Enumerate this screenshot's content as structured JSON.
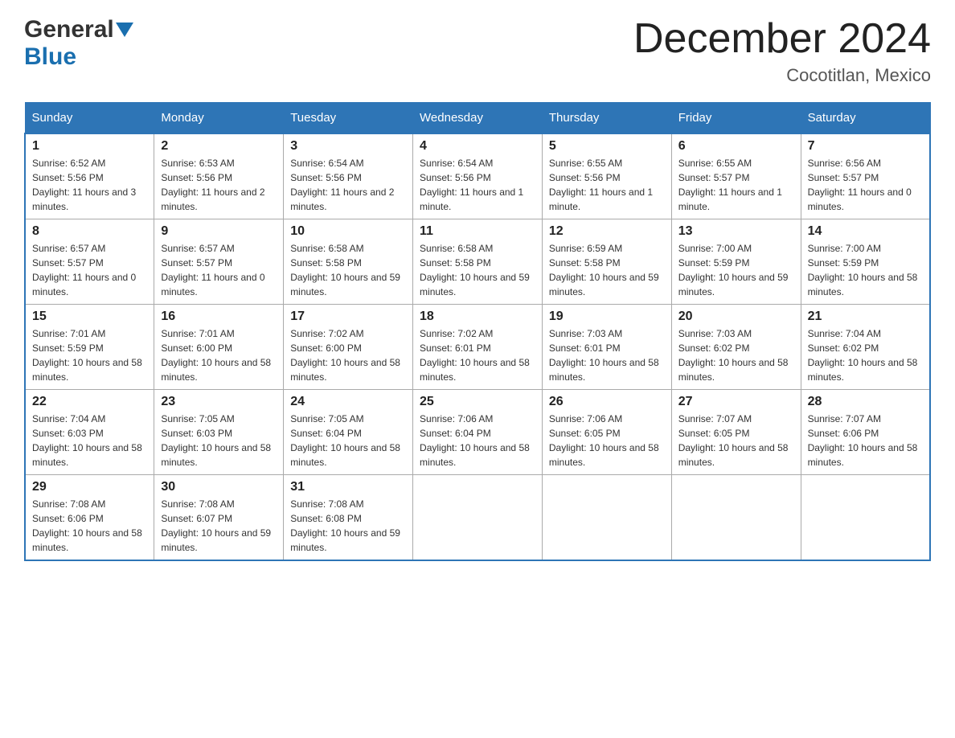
{
  "header": {
    "title": "December 2024",
    "location": "Cocotitlan, Mexico",
    "logo_general": "General",
    "logo_blue": "Blue"
  },
  "days_of_week": [
    "Sunday",
    "Monday",
    "Tuesday",
    "Wednesday",
    "Thursday",
    "Friday",
    "Saturday"
  ],
  "weeks": [
    [
      {
        "day": "1",
        "sunrise": "6:52 AM",
        "sunset": "5:56 PM",
        "daylight": "11 hours and 3 minutes."
      },
      {
        "day": "2",
        "sunrise": "6:53 AM",
        "sunset": "5:56 PM",
        "daylight": "11 hours and 2 minutes."
      },
      {
        "day": "3",
        "sunrise": "6:54 AM",
        "sunset": "5:56 PM",
        "daylight": "11 hours and 2 minutes."
      },
      {
        "day": "4",
        "sunrise": "6:54 AM",
        "sunset": "5:56 PM",
        "daylight": "11 hours and 1 minute."
      },
      {
        "day": "5",
        "sunrise": "6:55 AM",
        "sunset": "5:56 PM",
        "daylight": "11 hours and 1 minute."
      },
      {
        "day": "6",
        "sunrise": "6:55 AM",
        "sunset": "5:57 PM",
        "daylight": "11 hours and 1 minute."
      },
      {
        "day": "7",
        "sunrise": "6:56 AM",
        "sunset": "5:57 PM",
        "daylight": "11 hours and 0 minutes."
      }
    ],
    [
      {
        "day": "8",
        "sunrise": "6:57 AM",
        "sunset": "5:57 PM",
        "daylight": "11 hours and 0 minutes."
      },
      {
        "day": "9",
        "sunrise": "6:57 AM",
        "sunset": "5:57 PM",
        "daylight": "11 hours and 0 minutes."
      },
      {
        "day": "10",
        "sunrise": "6:58 AM",
        "sunset": "5:58 PM",
        "daylight": "10 hours and 59 minutes."
      },
      {
        "day": "11",
        "sunrise": "6:58 AM",
        "sunset": "5:58 PM",
        "daylight": "10 hours and 59 minutes."
      },
      {
        "day": "12",
        "sunrise": "6:59 AM",
        "sunset": "5:58 PM",
        "daylight": "10 hours and 59 minutes."
      },
      {
        "day": "13",
        "sunrise": "7:00 AM",
        "sunset": "5:59 PM",
        "daylight": "10 hours and 59 minutes."
      },
      {
        "day": "14",
        "sunrise": "7:00 AM",
        "sunset": "5:59 PM",
        "daylight": "10 hours and 58 minutes."
      }
    ],
    [
      {
        "day": "15",
        "sunrise": "7:01 AM",
        "sunset": "5:59 PM",
        "daylight": "10 hours and 58 minutes."
      },
      {
        "day": "16",
        "sunrise": "7:01 AM",
        "sunset": "6:00 PM",
        "daylight": "10 hours and 58 minutes."
      },
      {
        "day": "17",
        "sunrise": "7:02 AM",
        "sunset": "6:00 PM",
        "daylight": "10 hours and 58 minutes."
      },
      {
        "day": "18",
        "sunrise": "7:02 AM",
        "sunset": "6:01 PM",
        "daylight": "10 hours and 58 minutes."
      },
      {
        "day": "19",
        "sunrise": "7:03 AM",
        "sunset": "6:01 PM",
        "daylight": "10 hours and 58 minutes."
      },
      {
        "day": "20",
        "sunrise": "7:03 AM",
        "sunset": "6:02 PM",
        "daylight": "10 hours and 58 minutes."
      },
      {
        "day": "21",
        "sunrise": "7:04 AM",
        "sunset": "6:02 PM",
        "daylight": "10 hours and 58 minutes."
      }
    ],
    [
      {
        "day": "22",
        "sunrise": "7:04 AM",
        "sunset": "6:03 PM",
        "daylight": "10 hours and 58 minutes."
      },
      {
        "day": "23",
        "sunrise": "7:05 AM",
        "sunset": "6:03 PM",
        "daylight": "10 hours and 58 minutes."
      },
      {
        "day": "24",
        "sunrise": "7:05 AM",
        "sunset": "6:04 PM",
        "daylight": "10 hours and 58 minutes."
      },
      {
        "day": "25",
        "sunrise": "7:06 AM",
        "sunset": "6:04 PM",
        "daylight": "10 hours and 58 minutes."
      },
      {
        "day": "26",
        "sunrise": "7:06 AM",
        "sunset": "6:05 PM",
        "daylight": "10 hours and 58 minutes."
      },
      {
        "day": "27",
        "sunrise": "7:07 AM",
        "sunset": "6:05 PM",
        "daylight": "10 hours and 58 minutes."
      },
      {
        "day": "28",
        "sunrise": "7:07 AM",
        "sunset": "6:06 PM",
        "daylight": "10 hours and 58 minutes."
      }
    ],
    [
      {
        "day": "29",
        "sunrise": "7:08 AM",
        "sunset": "6:06 PM",
        "daylight": "10 hours and 58 minutes."
      },
      {
        "day": "30",
        "sunrise": "7:08 AM",
        "sunset": "6:07 PM",
        "daylight": "10 hours and 59 minutes."
      },
      {
        "day": "31",
        "sunrise": "7:08 AM",
        "sunset": "6:08 PM",
        "daylight": "10 hours and 59 minutes."
      },
      null,
      null,
      null,
      null
    ]
  ],
  "labels": {
    "sunrise": "Sunrise:",
    "sunset": "Sunset:",
    "daylight": "Daylight:"
  }
}
